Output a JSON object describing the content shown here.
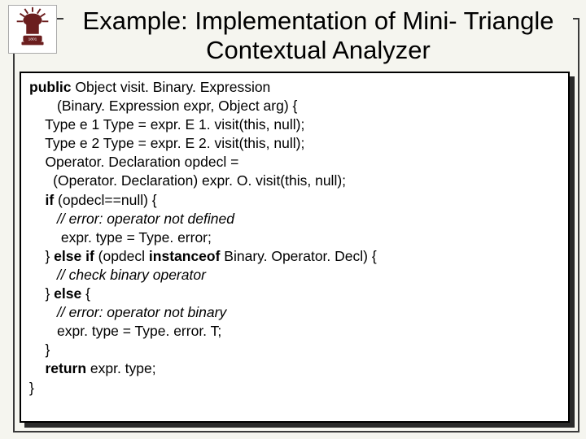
{
  "title": "Example: Implementation of Mini-\nTriangle Contextual Analyzer",
  "code": {
    "l1a": "public",
    "l1b": " Object visit. Binary. Expression",
    "l2": "       (Binary. Expression expr, Object arg) {",
    "l3": "    Type e 1 Type = expr. E 1. visit(this, null);",
    "l4": "    Type e 2 Type = expr. E 2. visit(this, null);",
    "l5": "    Operator. Declaration opdecl =",
    "l6": "      (Operator. Declaration) expr. O. visit(this, null);",
    "l7a": "    ",
    "l7b": "if",
    "l7c": " (opdecl==null) {",
    "l8": "// error: operator not defined",
    "l9": "        expr. type = Type. error;",
    "l10a": "    } ",
    "l10b": "else if",
    "l10c": " (opdecl ",
    "l10d": "instanceof",
    "l10e": " Binary. Operator. Decl) {",
    "l11": "// check binary operator",
    "l12a": "    } ",
    "l12b": "else",
    "l12c": " {",
    "l13": "// error: operator not binary",
    "l14": "       expr. type = Type. error. T;",
    "l15": "    }",
    "l16a": "    ",
    "l16b": "return",
    "l16c": " expr. type;",
    "l17": "}"
  }
}
